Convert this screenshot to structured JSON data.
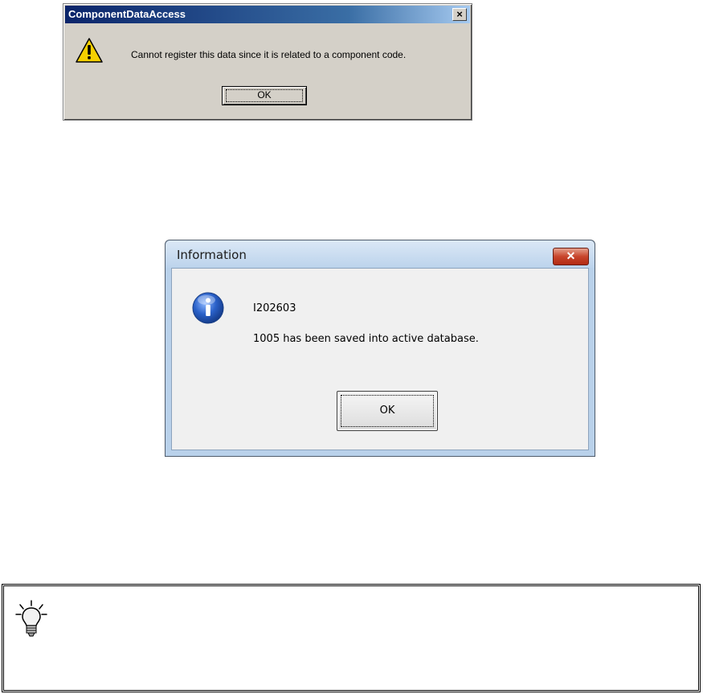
{
  "dialog1": {
    "title": "ComponentDataAccess",
    "close_label": "×",
    "icon": "warning-icon",
    "message": "Cannot register this data since it is related to a component code.",
    "ok_label": "OK"
  },
  "dialog2": {
    "title": "Information",
    "close_label": "✕",
    "icon": "info-icon",
    "line1": "I202603",
    "line2": "1005 has been saved into active database.",
    "ok_label": "OK"
  },
  "tip_box": {
    "icon": "lightbulb-icon"
  },
  "colors": {
    "classic_title_start": "#0a246a",
    "classic_face": "#d4d0c8",
    "win7_frame": "#b9d1ea",
    "win7_close_red": "#c8452c",
    "info_blue": "#2a61c9",
    "warning_yellow": "#f5d000"
  }
}
